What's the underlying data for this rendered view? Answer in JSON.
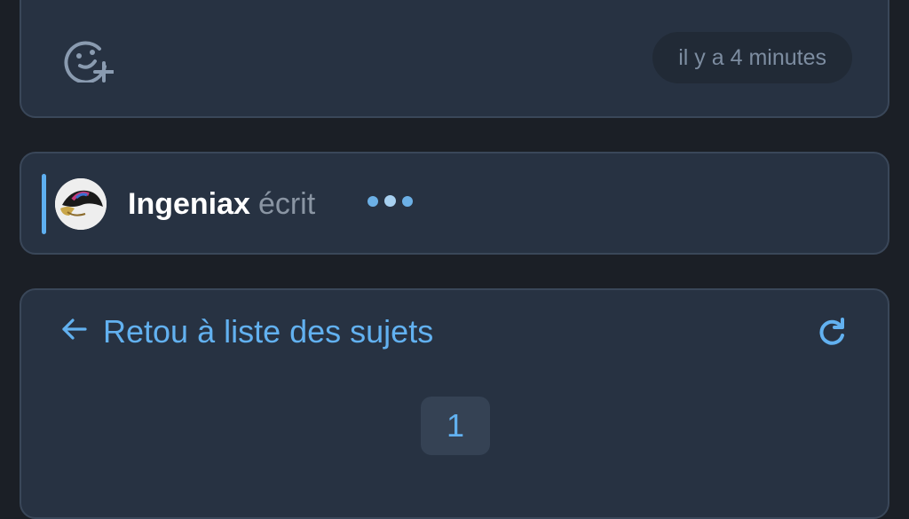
{
  "post": {
    "react_icon": "emoji-add-icon",
    "timestamp": "il y a 4 minutes"
  },
  "typing": {
    "username": "Ingeniax",
    "verb": "écrit",
    "avatar_icon": "user-avatar"
  },
  "navigation": {
    "back_icon": "arrow-left-icon",
    "back_label": "Retou à liste des sujets",
    "refresh_icon": "refresh-icon",
    "current_page": "1"
  },
  "colors": {
    "accent": "#62b1f0",
    "card_bg": "#273242",
    "page_bg": "#1b1f26",
    "card_border": "#3a4759"
  }
}
